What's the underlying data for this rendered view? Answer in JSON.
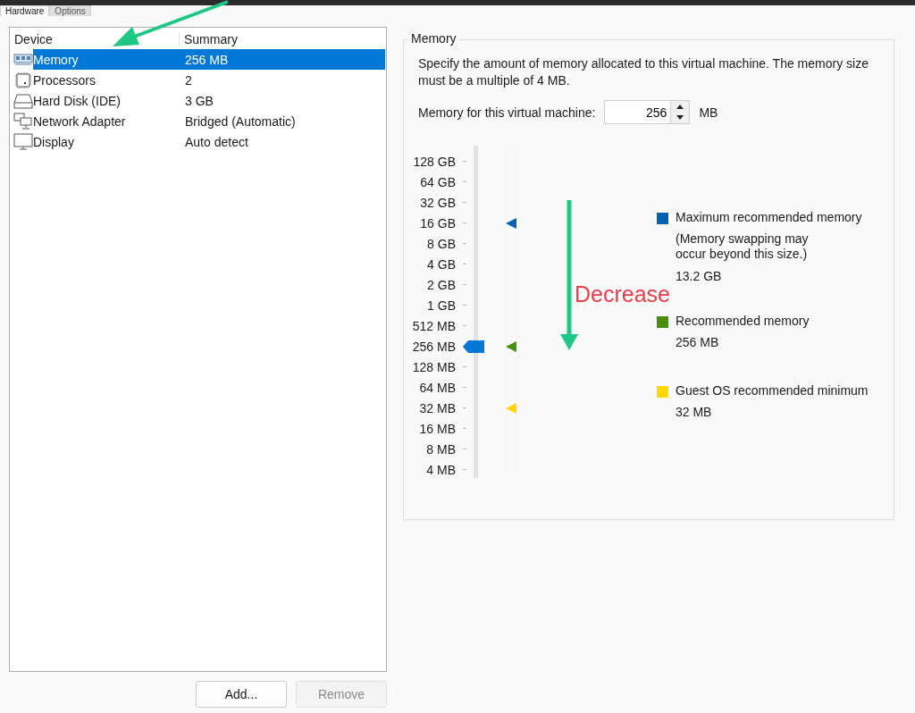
{
  "tabs": [
    {
      "label": "Hardware",
      "selected": true
    },
    {
      "label": "Options",
      "selected": false
    }
  ],
  "device_list": {
    "columns": [
      "Device",
      "Summary"
    ],
    "rows": [
      {
        "kind": "memory",
        "device": "Memory",
        "summary": "256 MB",
        "selected": true
      },
      {
        "kind": "processor",
        "device": "Processors",
        "summary": "2",
        "selected": false
      },
      {
        "kind": "disk",
        "device": "Hard Disk (IDE)",
        "summary": "3 GB",
        "selected": false
      },
      {
        "kind": "network",
        "device": "Network Adapter",
        "summary": "Bridged (Automatic)",
        "selected": false
      },
      {
        "kind": "display",
        "device": "Display",
        "summary": "Auto detect",
        "selected": false
      }
    ]
  },
  "buttons": [
    {
      "label": "Add...",
      "disabled": false
    },
    {
      "label": "Remove",
      "disabled": true
    }
  ],
  "memory_group": {
    "title": "Memory",
    "description": "Specify the amount of memory allocated to this virtual machine. The memory size must be a multiple of 4 MB.",
    "field_label": "Memory for this virtual machine:",
    "value": "256",
    "unit": "MB",
    "slider": {
      "ticks": [
        "128 GB",
        "64 GB",
        "32 GB",
        "16 GB",
        "8 GB",
        "4 GB",
        "2 GB",
        "1 GB",
        "512 MB",
        "256 MB",
        "128 MB",
        "64 MB",
        "32 MB",
        "16 MB",
        "8 MB",
        "4 MB"
      ],
      "level": 0.4
    },
    "legend": [
      {
        "label": "Maximum recommended memory",
        "note_lines": [
          "(Memory swapping may",
          "occur beyond this size.)"
        ],
        "value": "13.2 GB",
        "color": "#0063b1",
        "level": 0.8
      },
      {
        "label": "Recommended memory",
        "value": "256 MB",
        "color": "#498f0c",
        "level": 0.4
      },
      {
        "label": "Guest OS recommended minimum",
        "value": "32 MB",
        "color": "#ffd800",
        "level": 0.2
      }
    ]
  },
  "annotations": [
    {
      "kind": "arrow"
    },
    {
      "kind": "labeled_arrow",
      "text": "Decrease"
    }
  ]
}
